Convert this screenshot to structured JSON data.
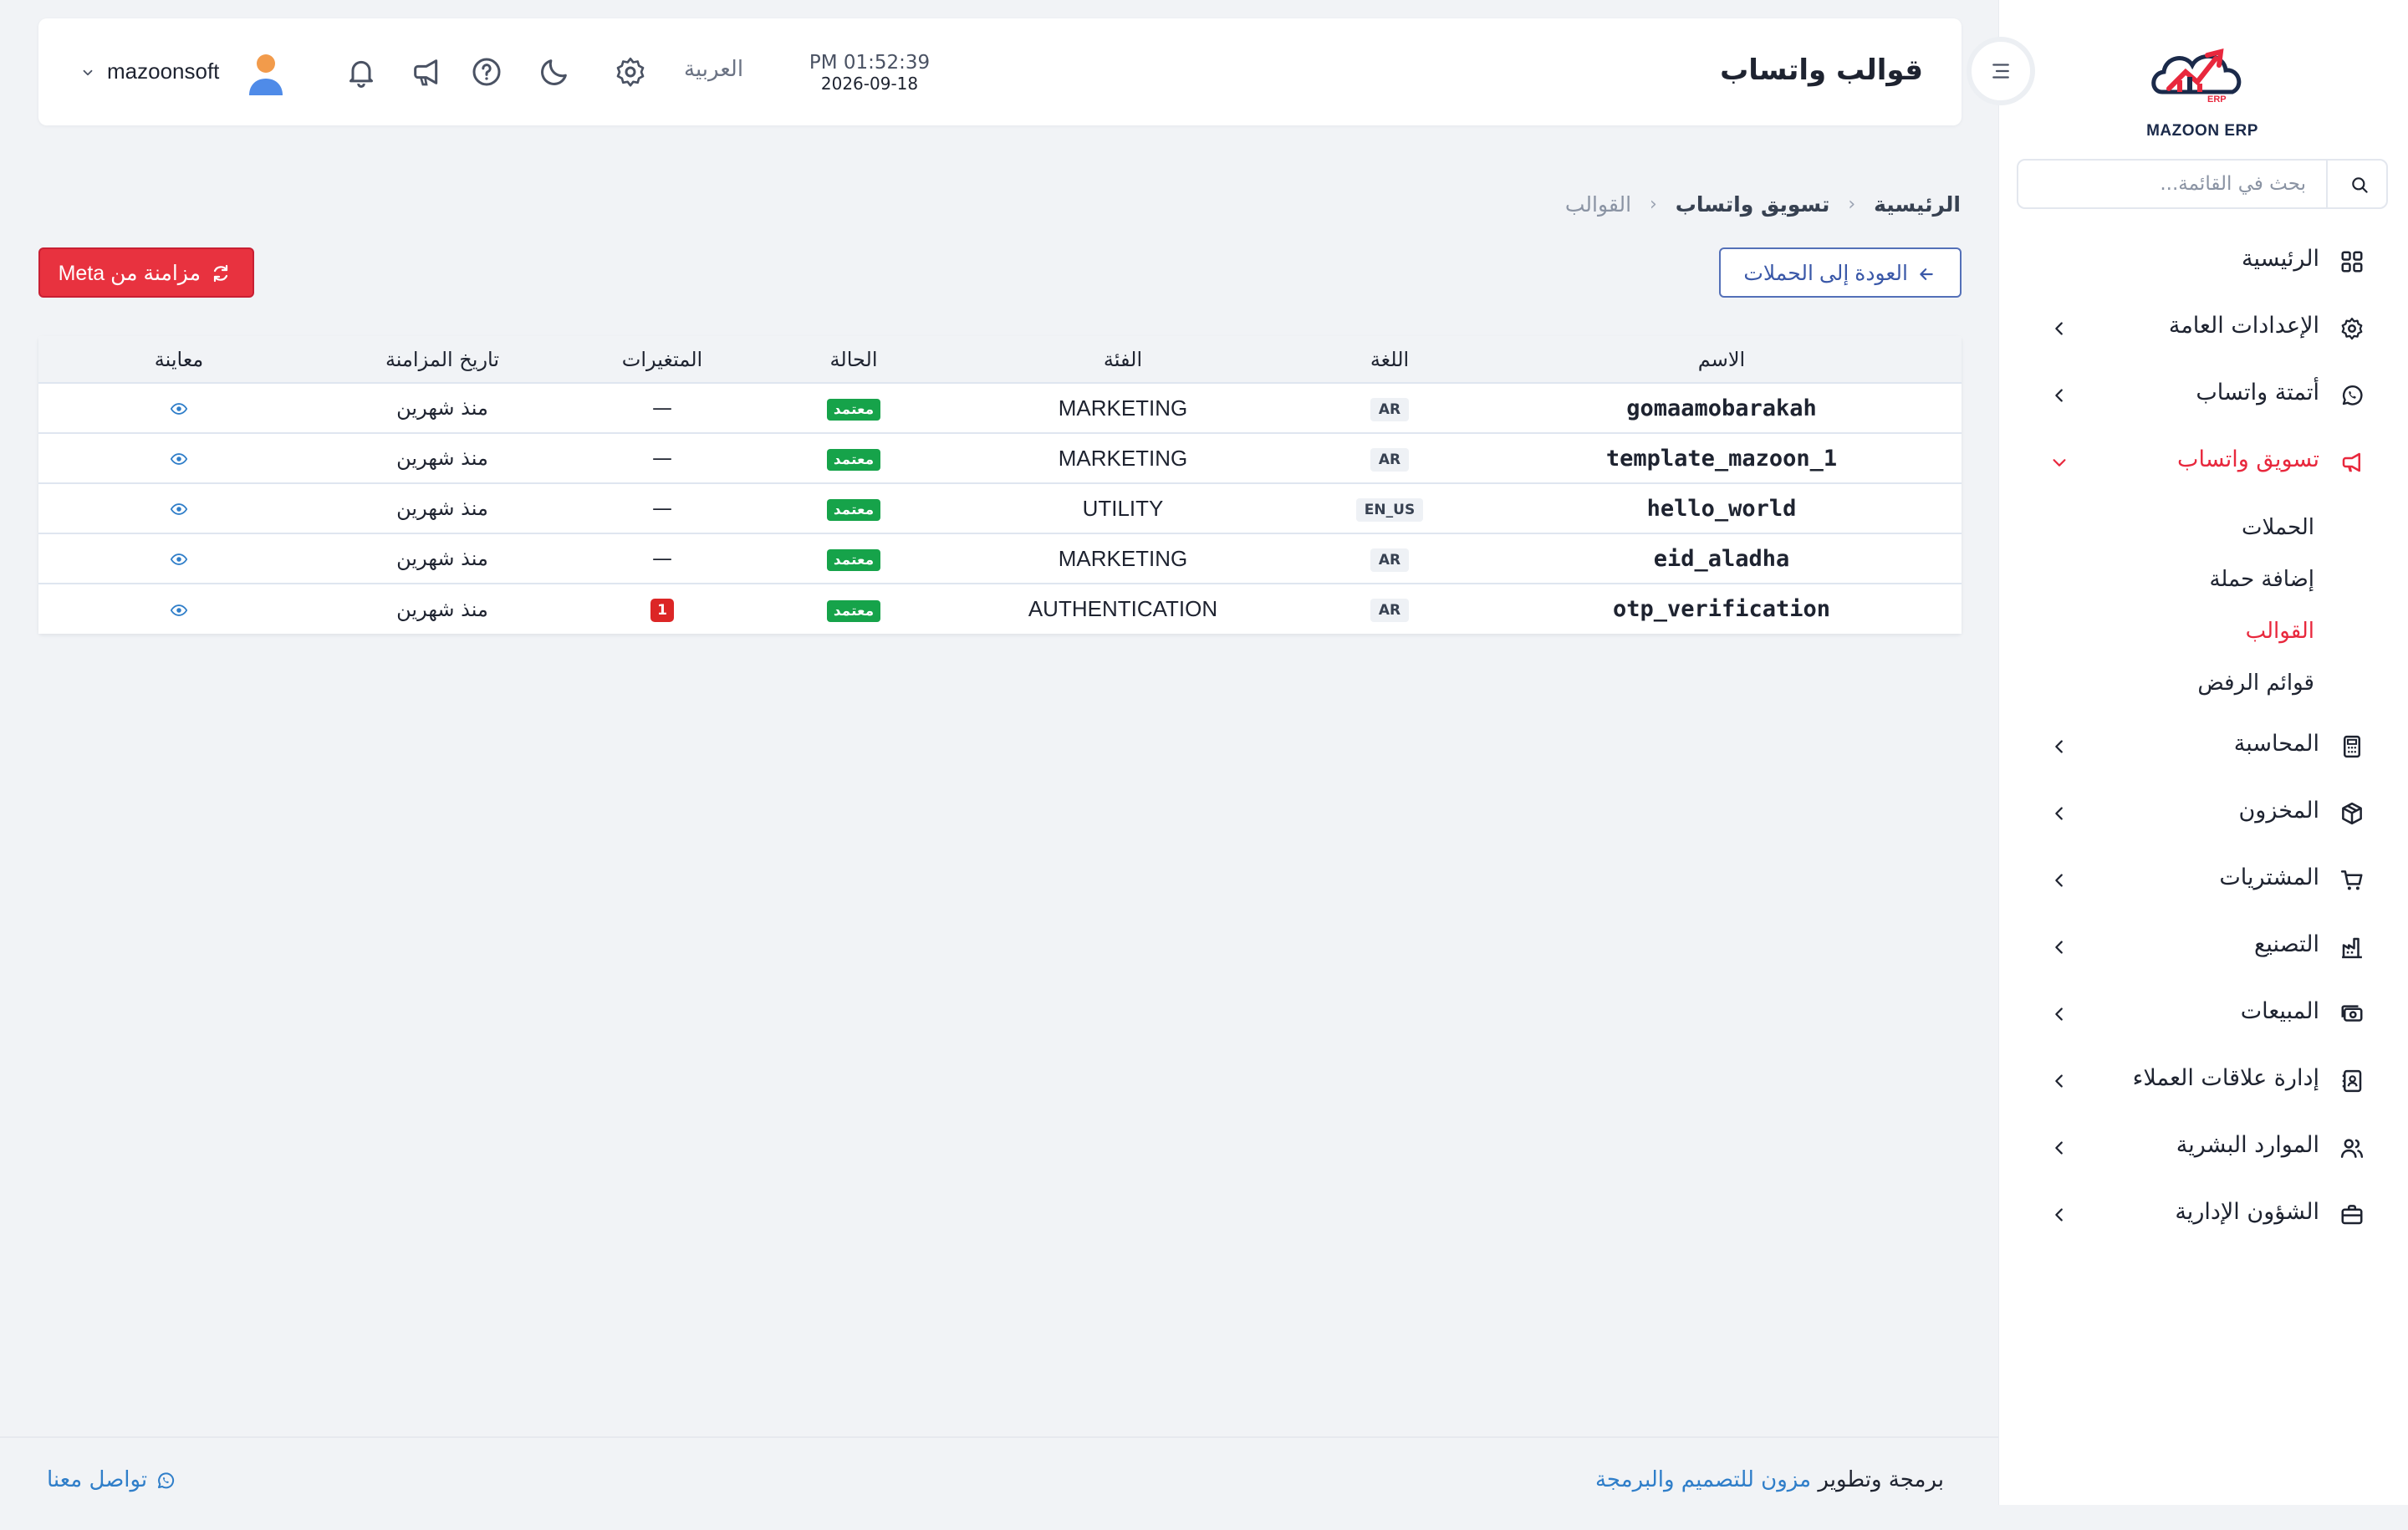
{
  "app": {
    "brand": "MAZOON ERP",
    "brand_tag": "ERP"
  },
  "header": {
    "title": "قوالب واتساب",
    "time": "PM 01:52:39",
    "date": "2026-09-18",
    "language": "العربية",
    "username": "mazoonsoft"
  },
  "sidebar": {
    "search_placeholder": "بحث في القائمة...",
    "items": [
      {
        "label": "الرئيسية",
        "icon": "grid-icon"
      },
      {
        "label": "الإعدادات العامة",
        "icon": "gear-icon"
      },
      {
        "label": "أتمتة واتساب",
        "icon": "whatsapp-icon"
      },
      {
        "label": "تسويق واتساب",
        "icon": "megaphone-icon"
      },
      {
        "label": "المحاسبة",
        "icon": "calculator-icon"
      },
      {
        "label": "المخزون",
        "icon": "box-icon"
      },
      {
        "label": "المشتريات",
        "icon": "cart-icon"
      },
      {
        "label": "التصنيع",
        "icon": "factory-icon"
      },
      {
        "label": "المبيعات",
        "icon": "cash-icon"
      },
      {
        "label": "إدارة علاقات العملاء",
        "icon": "contacts-icon"
      },
      {
        "label": "الموارد البشرية",
        "icon": "users-icon"
      },
      {
        "label": "الشؤون الإدارية",
        "icon": "briefcase-icon"
      }
    ],
    "sub_items": [
      {
        "label": "الحملات"
      },
      {
        "label": "إضافة حملة"
      },
      {
        "label": "القوالب"
      },
      {
        "label": "قوائم الرفض"
      }
    ],
    "active_item": "تسويق واتساب",
    "active_sub_item": "القوالب"
  },
  "breadcrumb": {
    "home": "الرئيسية",
    "section": "تسويق واتساب",
    "current": "القوالب"
  },
  "actions": {
    "back_label": "العودة إلى الحملات",
    "sync_label": "مزامنة من Meta"
  },
  "table": {
    "columns": [
      "الاسم",
      "اللغة",
      "الفئة",
      "الحالة",
      "المتغيرات",
      "تاريخ المزامنة",
      "معاينة"
    ],
    "rows": [
      {
        "name": "gomaamobarakah",
        "language": "AR",
        "category": "MARKETING",
        "status": "معتمد",
        "variables": "—",
        "synced": "منذ شهرين"
      },
      {
        "name": "template_mazoon_1",
        "language": "AR",
        "category": "MARKETING",
        "status": "معتمد",
        "variables": "—",
        "synced": "منذ شهرين"
      },
      {
        "name": "hello_world",
        "language": "EN_US",
        "category": "UTILITY",
        "status": "معتمد",
        "variables": "—",
        "synced": "منذ شهرين"
      },
      {
        "name": "eid_aladha",
        "language": "AR",
        "category": "MARKETING",
        "status": "معتمد",
        "variables": "—",
        "synced": "منذ شهرين"
      },
      {
        "name": "otp_verification",
        "language": "AR",
        "category": "AUTHENTICATION",
        "status": "معتمد",
        "variables": "1",
        "synced": "منذ شهرين"
      }
    ]
  },
  "footer": {
    "credit_prefix": "برمجة وتطوير",
    "credit_link": "مزون للتصميم والبرمجة",
    "contact": "تواصل معنا"
  },
  "colors": {
    "accent_red": "#e8283d",
    "accent_blue": "#3a58a8",
    "status_green": "#16a34a",
    "link_blue": "#2f7ec9"
  }
}
